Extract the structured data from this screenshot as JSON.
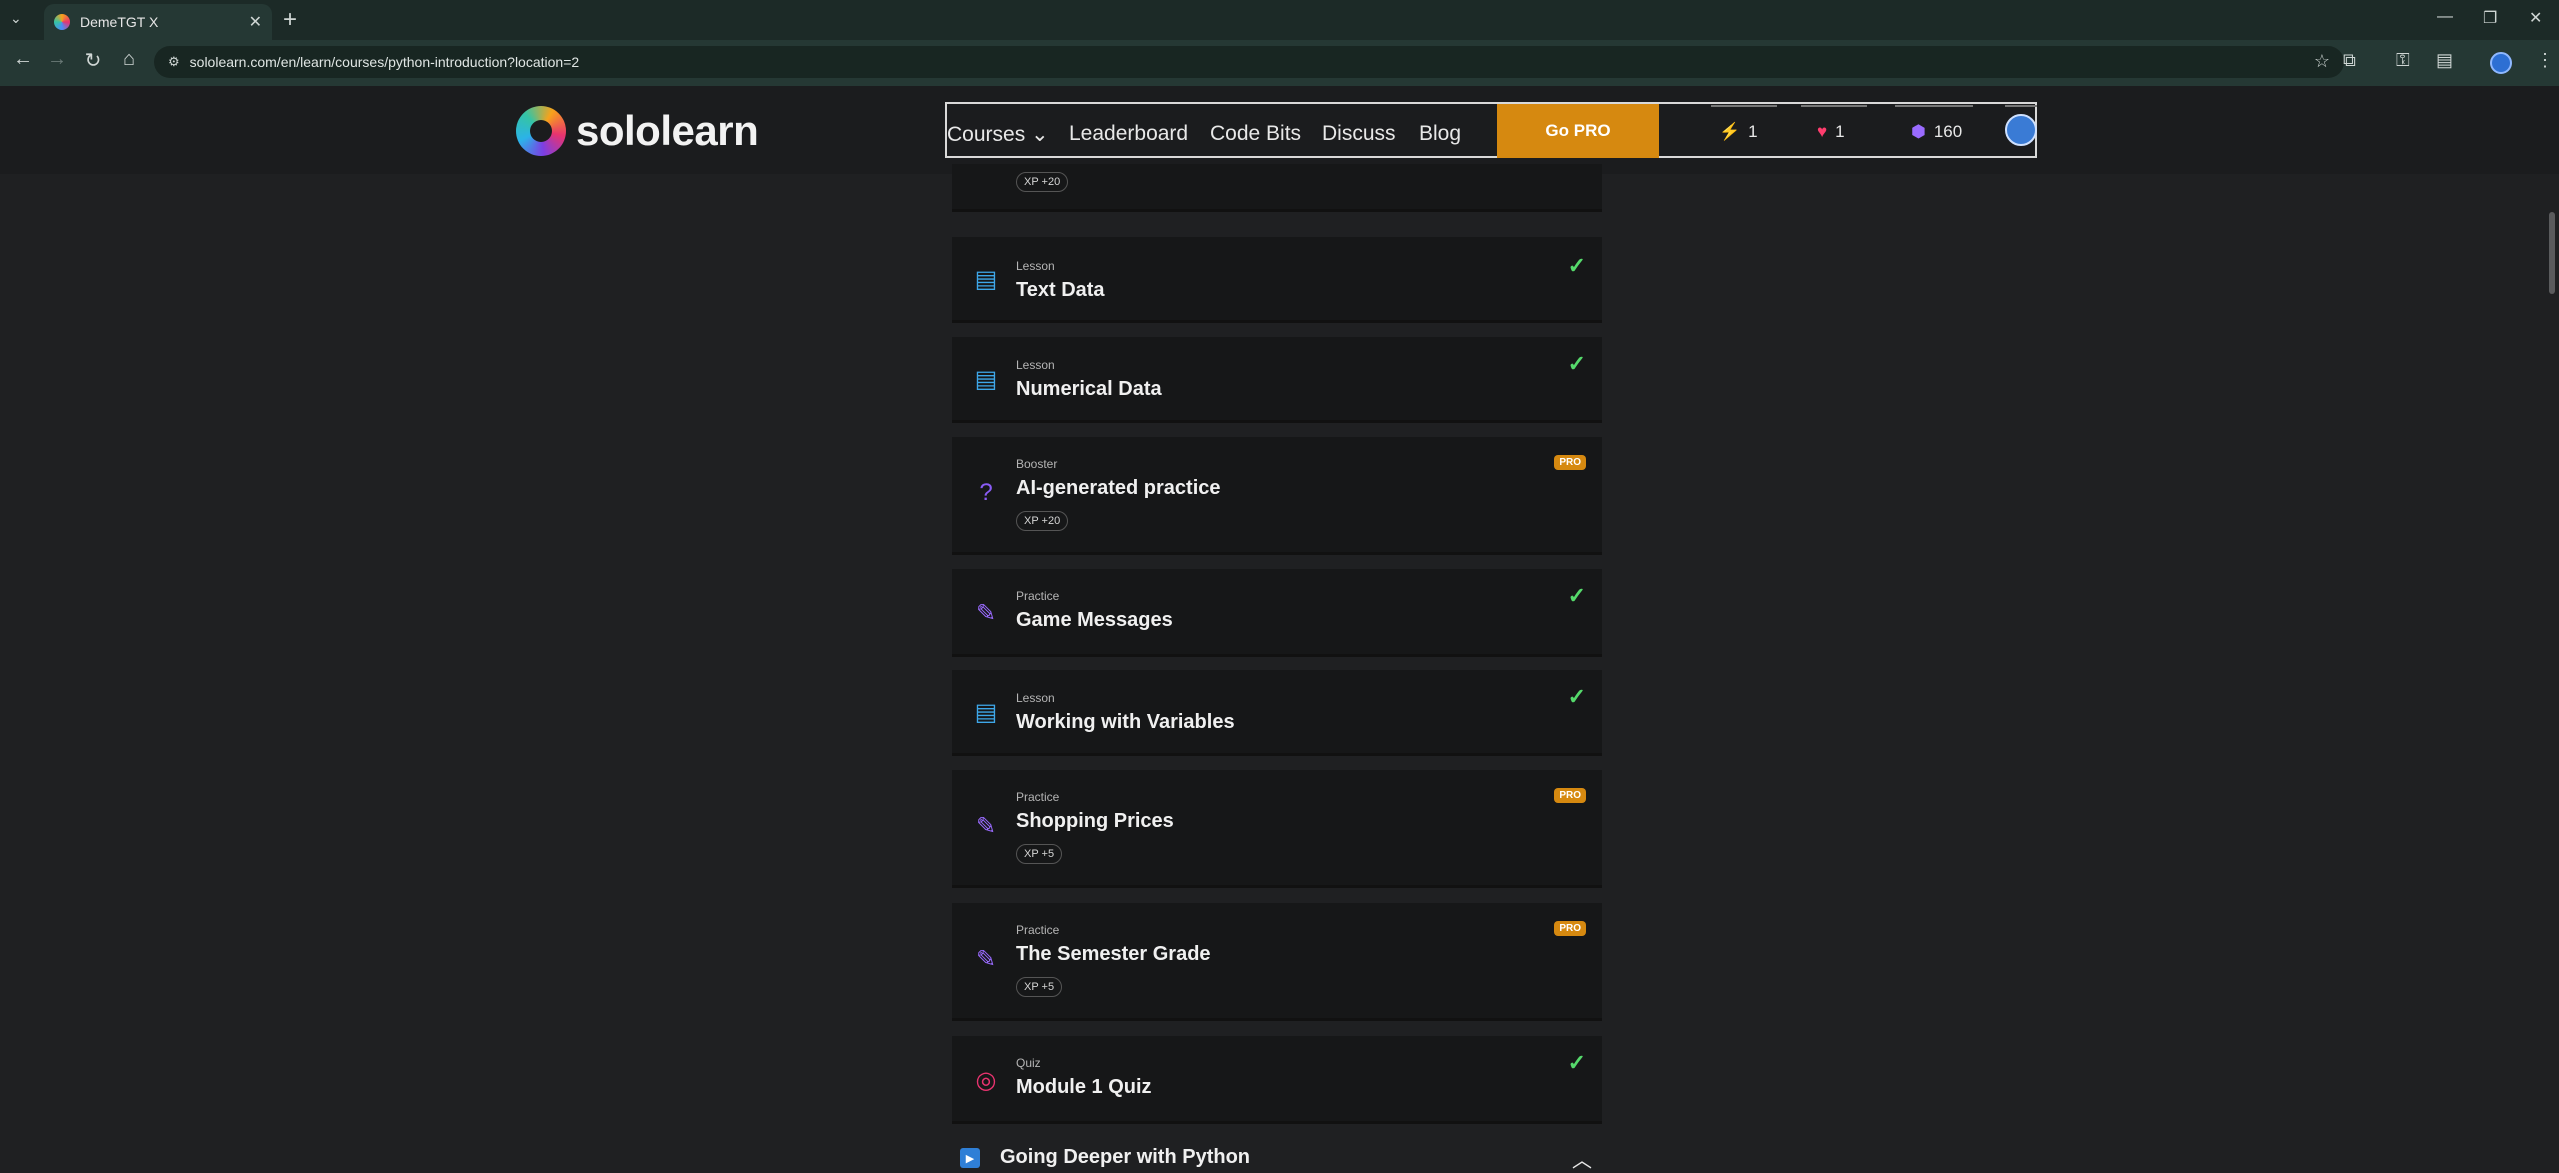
{
  "browser": {
    "tab_title": "DemeTGT X",
    "url": "sololearn.com/en/learn/courses/python-introduction?location=2"
  },
  "header": {
    "logo_text": "sololearn",
    "nav": {
      "courses": "Courses",
      "leaderboard": "Leaderboard",
      "code_bits": "Code Bits",
      "discuss": "Discuss",
      "blog": "Blog"
    },
    "go_pro": "Go PRO",
    "stats": {
      "streak": "1",
      "hearts": "1",
      "gems": "160"
    }
  },
  "top_partial": {
    "xp": "XP +20"
  },
  "items": [
    {
      "type": "Lesson",
      "title": "Text Data",
      "status": "completed"
    },
    {
      "type": "Lesson",
      "title": "Numerical Data",
      "status": "completed"
    },
    {
      "type": "Booster",
      "title": "AI-generated practice",
      "badge": "PRO",
      "xp": "XP +20"
    },
    {
      "type": "Practice",
      "title": "Game Messages",
      "status": "completed"
    },
    {
      "type": "Lesson",
      "title": "Working with Variables",
      "status": "completed"
    },
    {
      "type": "Practice",
      "title": "Shopping Prices",
      "badge": "PRO",
      "xp": "XP +5"
    },
    {
      "type": "Practice",
      "title": "The Semester Grade",
      "badge": "PRO",
      "xp": "XP +5"
    },
    {
      "type": "Quiz",
      "title": "Module 1 Quiz",
      "status": "completed"
    }
  ],
  "next_module": {
    "title": "Going Deeper with Python"
  },
  "colors": {
    "accent_pro": "#d68910",
    "check_green": "#55d96b",
    "lesson_blue": "#3ea7e8",
    "practice_purple": "#9a6bff",
    "quiz_red": "#e8336f"
  }
}
